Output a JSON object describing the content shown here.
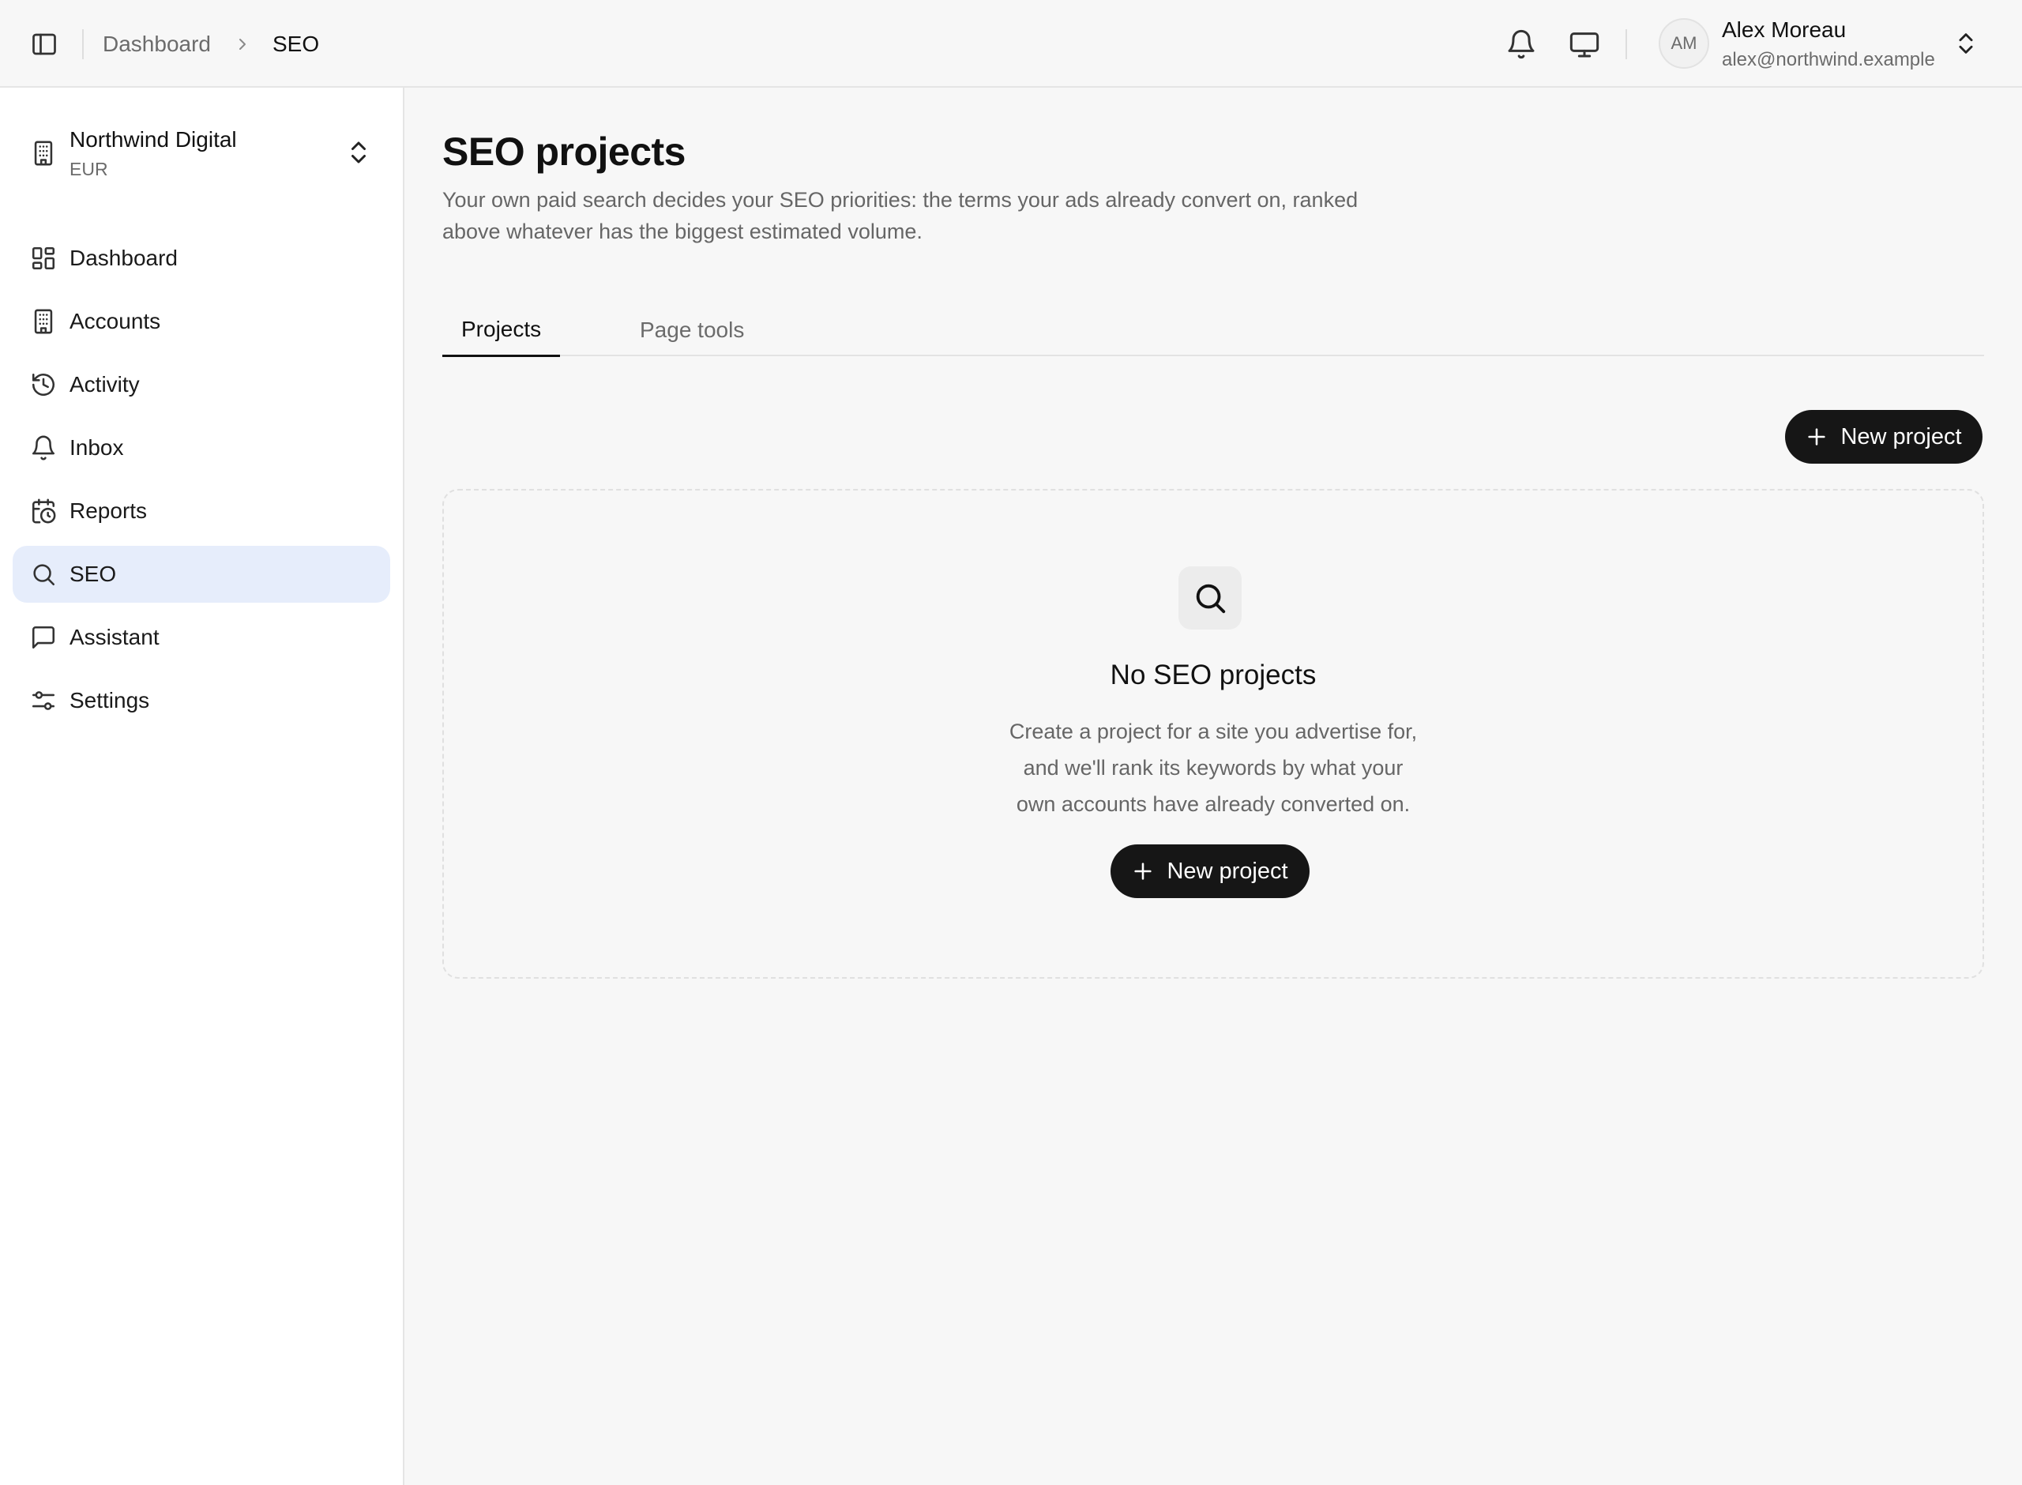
{
  "topbar": {
    "breadcrumb": {
      "parent": "Dashboard",
      "current": "SEO"
    },
    "user": {
      "initials": "AM",
      "name": "Alex Moreau",
      "email": "alex@northwind.example"
    },
    "icons": [
      "sidebar-toggle-icon",
      "chevron-right-icon",
      "bell-icon",
      "monitor-icon",
      "chevrons-up-down-icon"
    ]
  },
  "sidebar": {
    "org": {
      "name": "Northwind Digital",
      "currency": "EUR"
    },
    "items": [
      {
        "label": "Dashboard",
        "icon": "dashboard-icon",
        "active": false
      },
      {
        "label": "Accounts",
        "icon": "building-icon",
        "active": false
      },
      {
        "label": "Activity",
        "icon": "history-icon",
        "active": false
      },
      {
        "label": "Inbox",
        "icon": "bell-icon",
        "active": false
      },
      {
        "label": "Reports",
        "icon": "calendar-clock-icon",
        "active": false
      },
      {
        "label": "SEO",
        "icon": "search-icon",
        "active": true
      },
      {
        "label": "Assistant",
        "icon": "message-square-icon",
        "active": false
      },
      {
        "label": "Settings",
        "icon": "sliders-icon",
        "active": false
      }
    ]
  },
  "main": {
    "title": "SEO projects",
    "description": "Your own paid search decides your SEO priorities: the terms your ads already convert on, ranked above whatever has the biggest estimated volume.",
    "tabs": [
      {
        "label": "Projects",
        "active": true
      },
      {
        "label": "Page tools",
        "active": false
      }
    ],
    "new_project_label": "New project",
    "empty_state": {
      "title": "No SEO projects",
      "lines": [
        "Create a project for a site you advertise for,",
        "and we'll rank its keywords by what your",
        "own accounts have already converted on."
      ],
      "button_label": "New project"
    }
  },
  "colors": {
    "background": "#f7f7f7",
    "sidebar": "#ffffff",
    "active_nav": "#e6edfb",
    "button": "#161616"
  }
}
